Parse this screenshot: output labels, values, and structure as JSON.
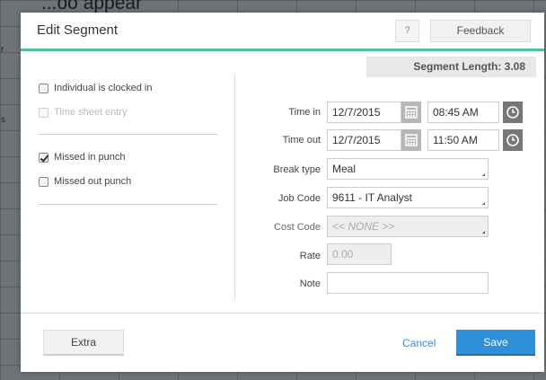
{
  "background": {
    "caption": "...oo appear",
    "letter_r": "r",
    "letter_s": "s"
  },
  "dialog": {
    "title": "Edit Segment",
    "help_label": "?",
    "feedback_label": "Feedback",
    "segment_length": "Segment Length: 3.08"
  },
  "options": {
    "individual_clocked_in": {
      "label": "Individual is clocked in",
      "checked": false,
      "disabled": false
    },
    "time_sheet_entry": {
      "label": "Time sheet entry",
      "checked": false,
      "disabled": true
    },
    "missed_in_punch": {
      "label": "Missed in punch",
      "checked": true,
      "disabled": false
    },
    "missed_out_punch": {
      "label": "Missed out punch",
      "checked": false,
      "disabled": false
    }
  },
  "form": {
    "time_in": {
      "label": "Time in",
      "date": "12/7/2015",
      "time": "08:45 AM"
    },
    "time_out": {
      "label": "Time out",
      "date": "12/7/2015",
      "time": "11:50 AM"
    },
    "break_type": {
      "label": "Break type",
      "value": "Meal"
    },
    "job_code": {
      "label": "Job Code",
      "value": "9611 - IT Analyst"
    },
    "cost_code": {
      "label": "Cost Code",
      "value": "<< NONE >>"
    },
    "rate": {
      "label": "Rate",
      "value": "0.00"
    },
    "note": {
      "label": "Note",
      "value": ""
    }
  },
  "footer": {
    "extra_label": "Extra",
    "cancel_label": "Cancel",
    "save_label": "Save"
  },
  "colors": {
    "accent": "#4dbf9b",
    "primary_button": "#2f8fd8",
    "link": "#3b8cd7"
  }
}
